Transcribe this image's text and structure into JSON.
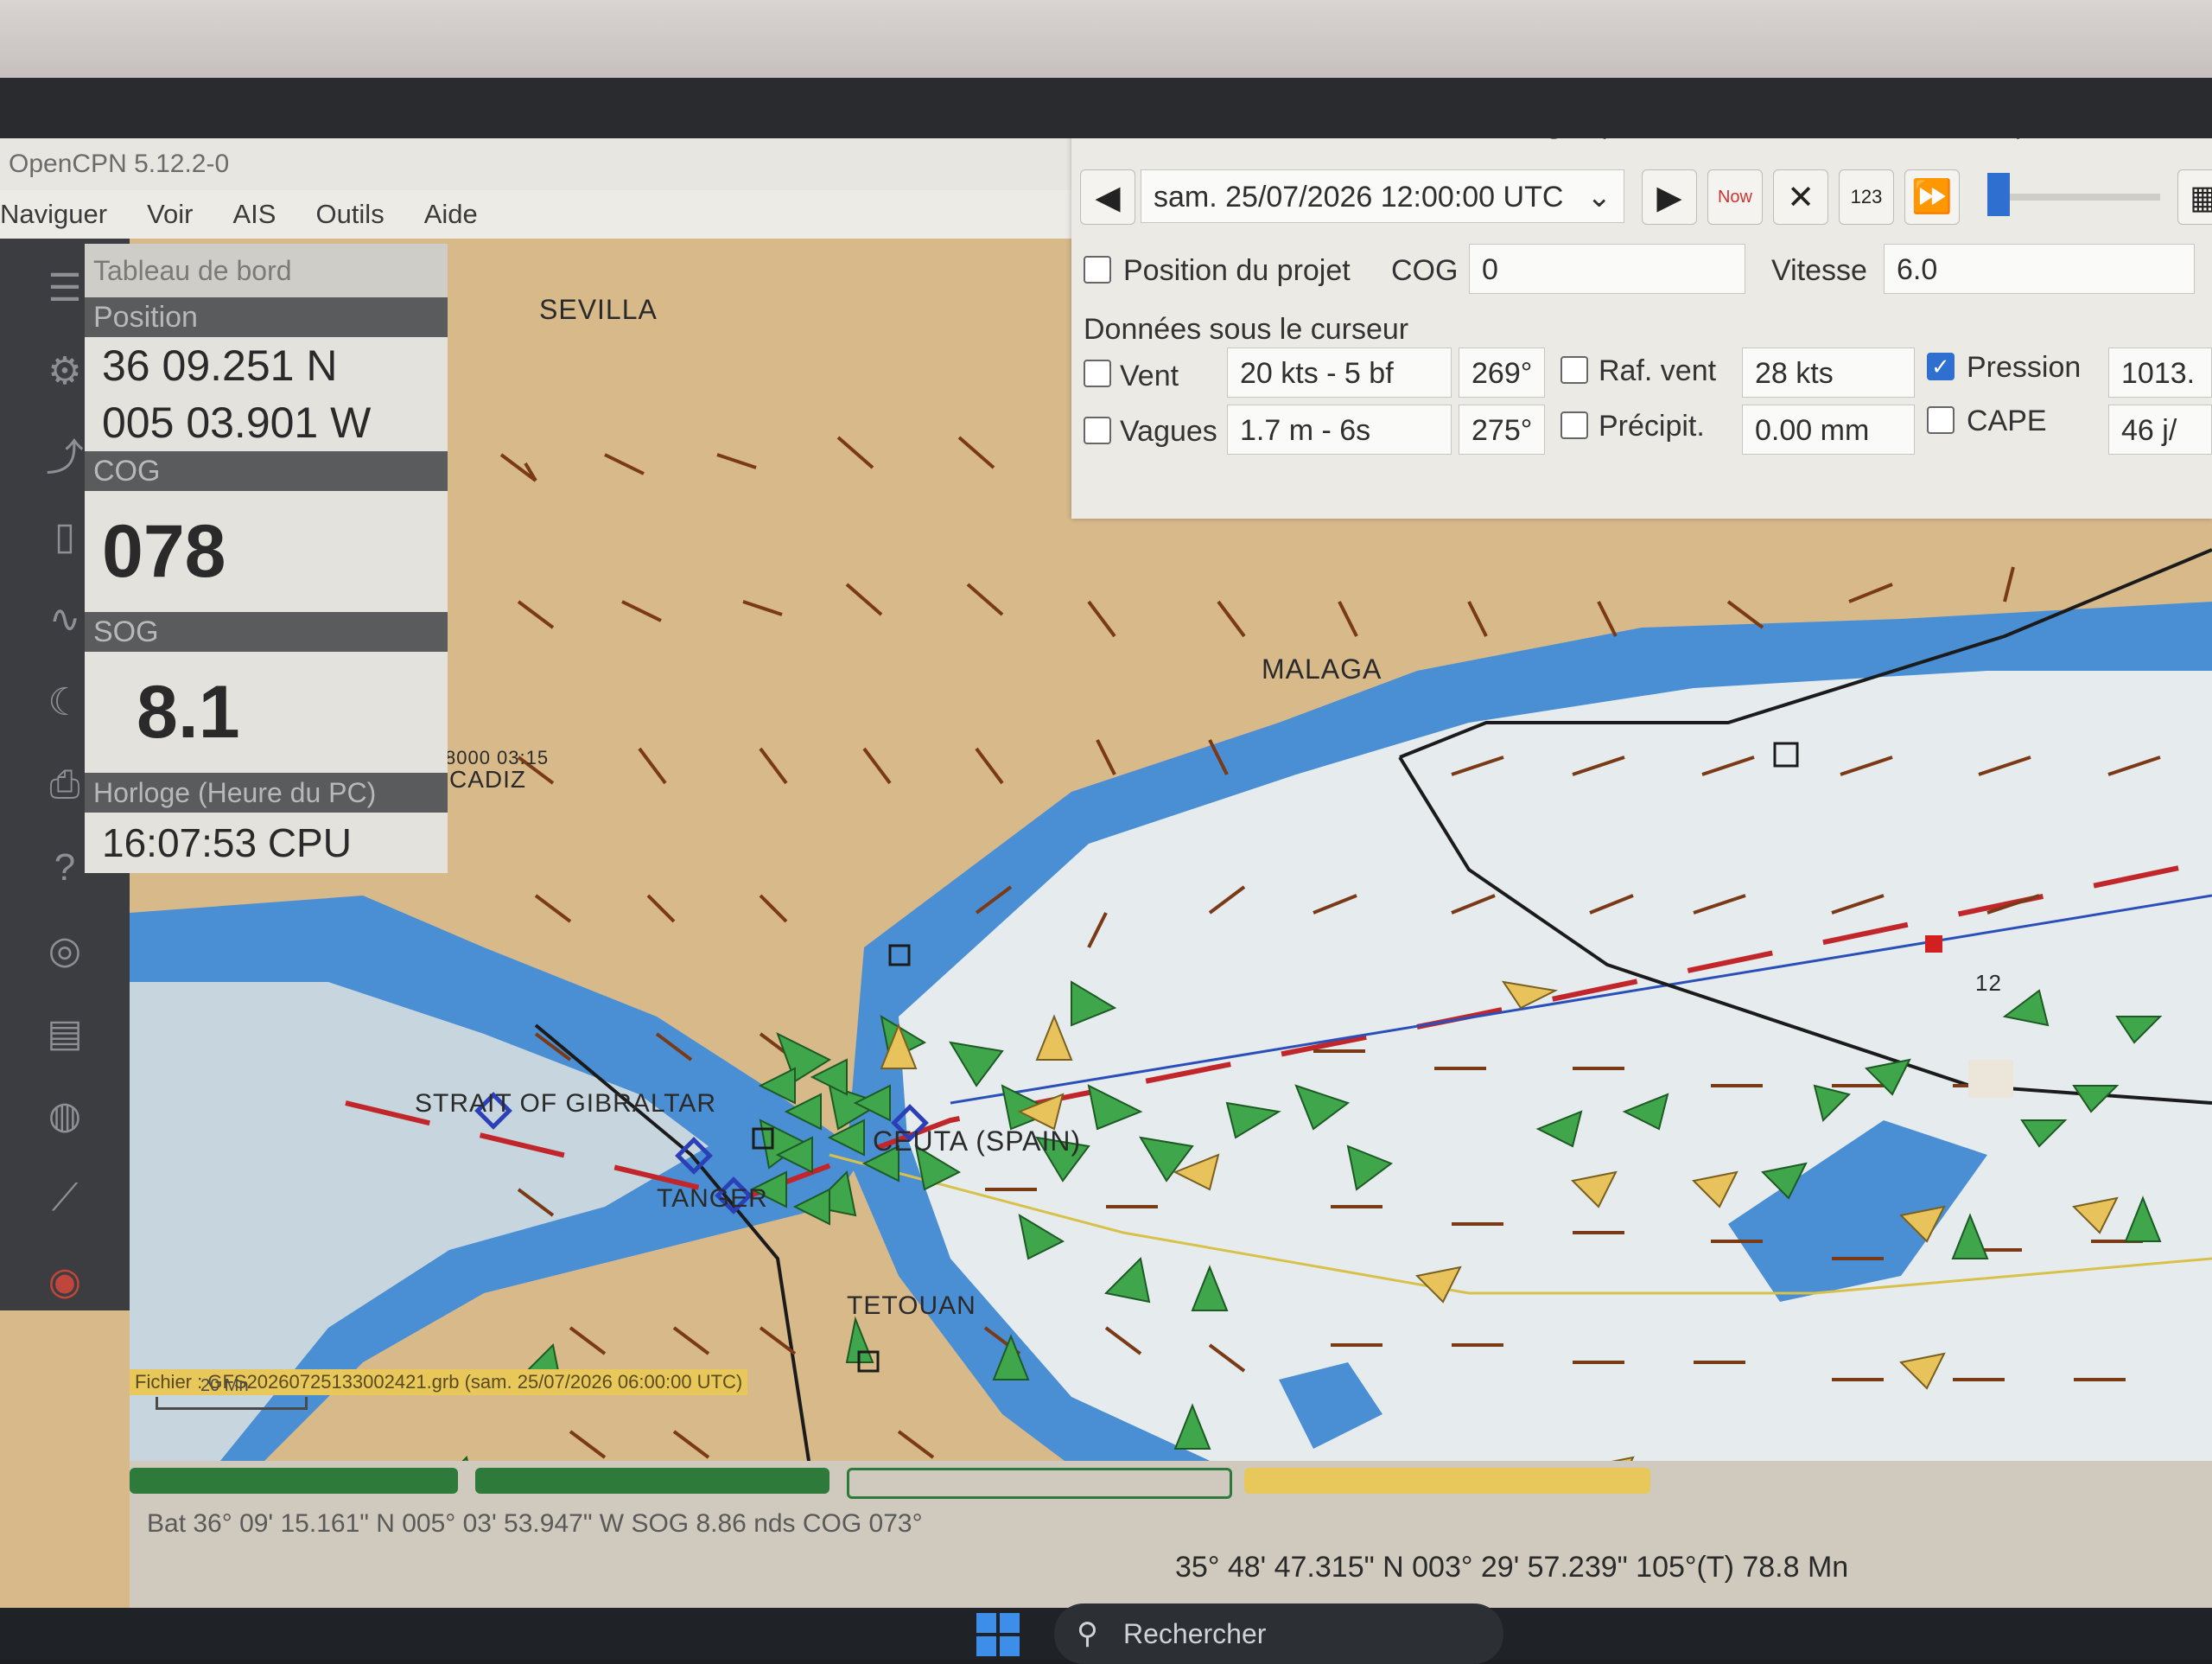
{
  "window": {
    "title": "OpenCPN 5.12.2-0"
  },
  "menu": [
    "Naviguer",
    "Voir",
    "AIS",
    "Outils",
    "Aide"
  ],
  "toolbar_icons": [
    "menu-icon",
    "settings-icon",
    "route-icon",
    "page-icon",
    "tracks-icon",
    "moon-icon",
    "print-icon",
    "help-icon",
    "compass-icon",
    "book-icon",
    "globe-icon",
    "measure-icon",
    "lifebuoy-icon"
  ],
  "dashboard": {
    "title": "Tableau de bord",
    "position_label": "Position",
    "lat": "36 09.251 N",
    "lon": "005 03.901 W",
    "cog_label": "COG",
    "cog": "078",
    "sog_label": "SOG",
    "sog": "8.1",
    "clock_label": "Horloge (Heure du PC)",
    "clock": "16:07:53 CPU"
  },
  "grib": {
    "file": "Fichier : GFS20260725133002421.grb (sam. 25/07/2026 06:00:00 UTC)",
    "datetime": "sam. 25/07/2026 12:00:00 UTC",
    "now_label": "Now",
    "num_label": "123",
    "project_label": "Position du projet",
    "cog_label": "COG",
    "cog_value": "0",
    "speed_label": "Vitesse",
    "speed_value": "6.0",
    "cursor_label": "Données sous le curseur",
    "wind_label": "Vent",
    "wind_value": "20 kts -  5 bf",
    "wind_dir": "269°",
    "gust_label": "Raf. vent",
    "gust_value": "28 kts",
    "pressure_label": "Pression",
    "pressure_value": "1013.",
    "waves_label": "Vagues",
    "waves_value": "1.7 m - 6s",
    "waves_dir": "275°",
    "precip_label": "Précipit.",
    "precip_value": "0.00 mm",
    "cape_label": "CAPE",
    "cape_value": "46 j/"
  },
  "places": {
    "sevilla": "SEVILLA",
    "malaga": "MALAGA",
    "strait": "STRAIT OF GIBRALTAR",
    "ceuta": "CEUTA (SPAIN)",
    "tanger": "TANGER",
    "tetouan": "TETOUAN",
    "cadiz": "CADIZ",
    "tide": "8000 03:15",
    "mark": "12"
  },
  "overlay": {
    "file": "Fichier : GFS20260725133002421.grb (sam. 25/07/2026 06:00:00 UTC)",
    "scale": "20 Mn"
  },
  "statusbar": {
    "ship": "Bat  36° 09' 15.161\" N   005° 03' 53.947\" W  SOG 8.86 nds   COG 073°",
    "cursor": "35° 48' 47.315\" N   003° 29' 57.239\" 105°(T)  78.8 Mn"
  },
  "taskbar": {
    "search": "Rechercher"
  },
  "colors": {
    "land": "#d7b98a",
    "shallow": "#4a8fd4",
    "deep": "#e6ecee",
    "wind": "#7a3a16",
    "ais": "#3fa64b",
    "route": "#c0262a"
  }
}
